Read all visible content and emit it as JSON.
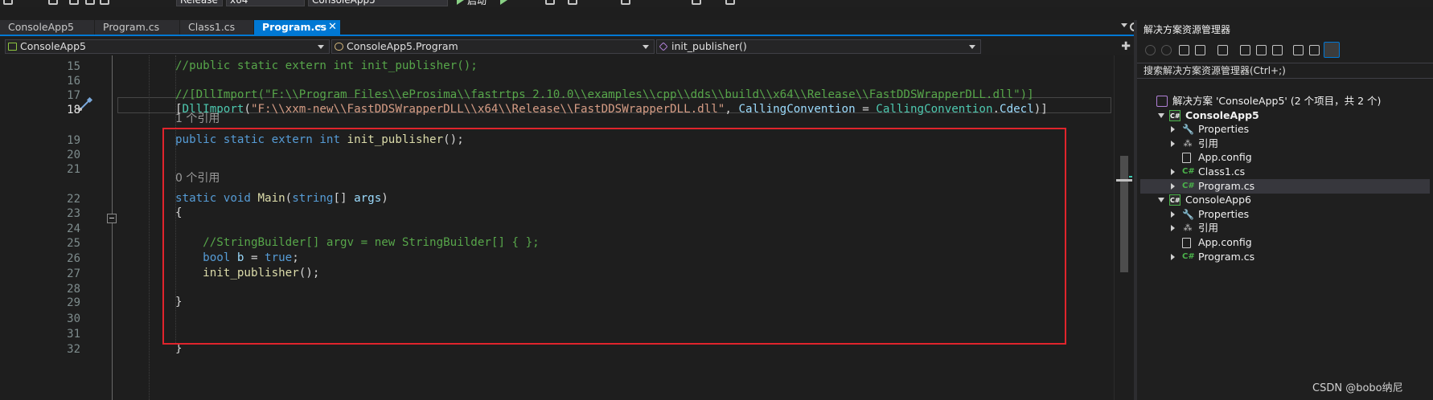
{
  "toolbar": {
    "config": "Release",
    "platform": "x64",
    "startup": "ConsoleApp5",
    "start_label": "启动"
  },
  "tabs": [
    {
      "label": "ConsoleApp5",
      "active": false
    },
    {
      "label": "Program.cs",
      "active": false
    },
    {
      "label": "Class1.cs",
      "active": false
    },
    {
      "label": "Program.cs",
      "active": true
    }
  ],
  "tab_icons": {
    "pin": "⊸",
    "close": "✕"
  },
  "navbar": {
    "project": "ConsoleApp5",
    "type": "ConsoleApp5.Program",
    "member": "init_publisher()",
    "split": "✚"
  },
  "editor": {
    "current_line": 18,
    "lines": [
      {
        "n": "15",
        "tokens": [
          {
            "c": "cm",
            "t": "//public static extern int init_publisher();"
          }
        ]
      },
      {
        "n": "16",
        "tokens": []
      },
      {
        "n": "17",
        "tokens": [
          {
            "c": "cm",
            "t": "//[DllImport(\"F:\\\\Program Files\\\\eProsima\\\\fastrtps 2.10.0\\\\examples\\\\cpp\\\\dds\\\\build\\\\x64\\\\Release\\\\FastDDSWrapperDLL.dll\")]"
          }
        ]
      },
      {
        "n": "18",
        "tokens": [
          {
            "c": "pl",
            "t": "["
          },
          {
            "c": "ty",
            "t": "DllImport"
          },
          {
            "c": "pl",
            "t": "("
          },
          {
            "c": "str",
            "t": "\"F:\\\\xxm-new\\\\FastDDSWrapperDLL\\\\x64\\\\Release\\\\FastDDSWrapperDLL.dll\""
          },
          {
            "c": "pl",
            "t": ", "
          },
          {
            "c": "vr",
            "t": "CallingConvention"
          },
          {
            "c": "pl",
            "t": " = "
          },
          {
            "c": "ty",
            "t": "CallingConvention"
          },
          {
            "c": "pl",
            "t": "."
          },
          {
            "c": "vr",
            "t": "Cdecl"
          },
          {
            "c": "pl",
            "t": ")]"
          }
        ]
      },
      {
        "n": "19",
        "tokens": [
          {
            "c": "kw",
            "t": "public static extern int "
          },
          {
            "c": "fn",
            "t": "init_publisher"
          },
          {
            "c": "pl",
            "t": "();"
          }
        ]
      },
      {
        "n": "20",
        "tokens": []
      },
      {
        "n": "21",
        "tokens": []
      },
      {
        "n": "22",
        "tokens": [
          {
            "c": "kw",
            "t": "static void "
          },
          {
            "c": "fn",
            "t": "Main"
          },
          {
            "c": "pl",
            "t": "("
          },
          {
            "c": "kw",
            "t": "string"
          },
          {
            "c": "pl",
            "t": "[] "
          },
          {
            "c": "vr",
            "t": "args"
          },
          {
            "c": "pl",
            "t": ")"
          }
        ]
      },
      {
        "n": "23",
        "tokens": [
          {
            "c": "pl",
            "t": "{"
          }
        ]
      },
      {
        "n": "24",
        "tokens": []
      },
      {
        "n": "25",
        "tokens": [
          {
            "c": "cm",
            "t": "    //StringBuilder[] argv = new StringBuilder[] { };"
          }
        ]
      },
      {
        "n": "26",
        "tokens": [
          {
            "c": "kw",
            "t": "    bool "
          },
          {
            "c": "vr",
            "t": "b"
          },
          {
            "c": "pl",
            "t": " = "
          },
          {
            "c": "kw",
            "t": "true"
          },
          {
            "c": "pl",
            "t": ";"
          }
        ]
      },
      {
        "n": "27",
        "tokens": [
          {
            "c": "fn",
            "t": "    init_publisher"
          },
          {
            "c": "pl",
            "t": "();"
          }
        ]
      },
      {
        "n": "28",
        "tokens": []
      },
      {
        "n": "29",
        "tokens": [
          {
            "c": "pl",
            "t": "}"
          }
        ]
      },
      {
        "n": "30",
        "tokens": []
      },
      {
        "n": "31",
        "tokens": []
      },
      {
        "n": "32",
        "tokens": [
          {
            "c": "pl",
            "t": "}"
          }
        ]
      }
    ],
    "lens_ref_19": "1 个引用",
    "lens_ref_22": "0 个引用"
  },
  "explorer": {
    "title": "解决方案资源管理器",
    "search_placeholder": "搜索解决方案资源管理器(Ctrl+;)",
    "tree": [
      {
        "label": "解决方案 'ConsoleApp5' (2 个项目，共 2 个)",
        "icon": "sln",
        "indent": 0,
        "arrow": "",
        "bold": false,
        "selected": false
      },
      {
        "label": "ConsoleApp5",
        "icon": "proj",
        "indent": 1,
        "arrow": "open",
        "bold": true,
        "selected": false
      },
      {
        "label": "Properties",
        "icon": "wrench",
        "indent": 2,
        "arrow": "closed",
        "bold": false,
        "selected": false
      },
      {
        "label": "引用",
        "icon": "ref",
        "indent": 2,
        "arrow": "closed",
        "bold": false,
        "selected": false
      },
      {
        "label": "App.config",
        "icon": "cfg",
        "indent": 2,
        "arrow": "",
        "bold": false,
        "selected": false
      },
      {
        "label": "Class1.cs",
        "icon": "cs",
        "indent": 2,
        "arrow": "closed",
        "bold": false,
        "selected": false
      },
      {
        "label": "Program.cs",
        "icon": "cs",
        "indent": 2,
        "arrow": "closed",
        "bold": false,
        "selected": true
      },
      {
        "label": "ConsoleApp6",
        "icon": "proj",
        "indent": 1,
        "arrow": "open",
        "bold": false,
        "selected": false
      },
      {
        "label": "Properties",
        "icon": "wrench",
        "indent": 2,
        "arrow": "closed",
        "bold": false,
        "selected": false
      },
      {
        "label": "引用",
        "icon": "ref",
        "indent": 2,
        "arrow": "closed",
        "bold": false,
        "selected": false
      },
      {
        "label": "App.config",
        "icon": "cfg",
        "indent": 2,
        "arrow": "",
        "bold": false,
        "selected": false
      },
      {
        "label": "Program.cs",
        "icon": "cs",
        "indent": 2,
        "arrow": "closed",
        "bold": false,
        "selected": false
      }
    ],
    "icon_glyphs": {
      "proj": "C#",
      "cs": "C#",
      "wrench": "🔧",
      "ref": "⁂",
      "sln": "",
      "cfg": ""
    }
  },
  "watermark": "CSDN @bobo纳尼"
}
